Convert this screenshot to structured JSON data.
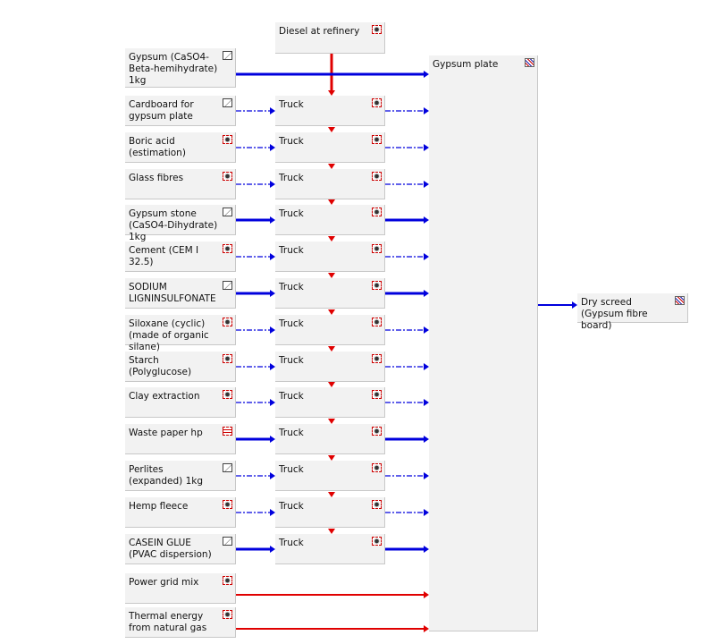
{
  "colors": {
    "flow_blue": "#0000dd",
    "flow_red": "#e00000"
  },
  "diesel": {
    "label": "Diesel at refinery",
    "icon": "gear"
  },
  "gypsum": {
    "label": "Gypsum (CaSO4-Beta-hemihydrate) 1kg",
    "icon": "doc"
  },
  "plate": {
    "label": "Gypsum plate",
    "icon": "plan"
  },
  "output": {
    "label": "Dry screed (Gypsum  fibre board)",
    "icon": "plan"
  },
  "truck_label": "Truck",
  "rows": [
    {
      "label": "Cardboard for gypsum plate",
      "icon": "doc",
      "style": "dashed"
    },
    {
      "label": "Boric acid (estimation)",
      "icon": "gear",
      "style": "dashed"
    },
    {
      "label": "Glass fibres",
      "icon": "gear",
      "style": "dashed"
    },
    {
      "label": "Gypsum stone (CaSO4-Dihydrate) 1kg",
      "icon": "doc",
      "style": "solid"
    },
    {
      "label": "Cement (CEM I  32.5)",
      "icon": "gear",
      "style": "dashed"
    },
    {
      "label": "SODIUM LIGNINSULFONATE",
      "icon": "doc",
      "style": "solid"
    },
    {
      "label": "Siloxane (cyclic) (made of organic silane)",
      "icon": "gear",
      "style": "dashed"
    },
    {
      "label": "Starch (Polyglucose)",
      "icon": "gear",
      "style": "dashed"
    },
    {
      "label": "Clay extraction",
      "icon": "gear",
      "style": "dashed"
    },
    {
      "label": "Waste paper hp",
      "icon": "waste",
      "style": "solid"
    },
    {
      "label": "Perlites (expanded) 1kg",
      "icon": "doc",
      "style": "dashed"
    },
    {
      "label": "Hemp fleece",
      "icon": "gear",
      "style": "dashed"
    },
    {
      "label": "CASEIN GLUE (PVAC dispersion)",
      "icon": "doc",
      "style": "solid"
    }
  ],
  "energy": [
    {
      "label": "Power grid mix",
      "icon": "gear"
    },
    {
      "label": "Thermal energy from natural gas",
      "icon": "gear"
    }
  ]
}
